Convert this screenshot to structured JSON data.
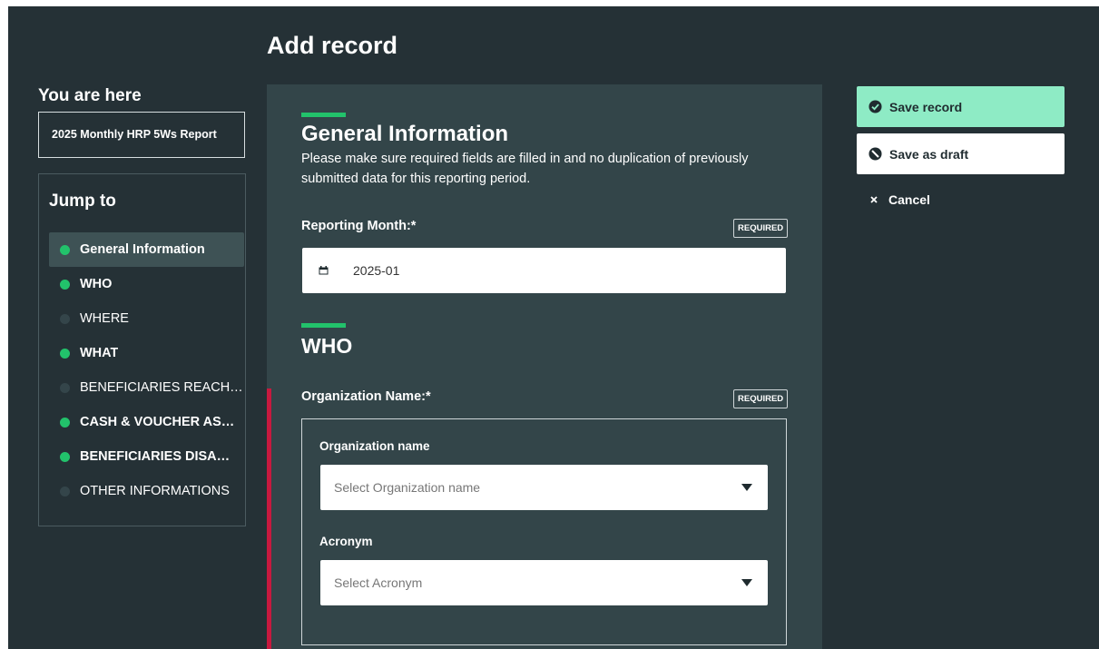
{
  "page": {
    "title": "Add record"
  },
  "sidebar": {
    "you_are_here": "You are here",
    "breadcrumb": "2025 Monthly HRP 5Ws Report",
    "jump_to": "Jump to",
    "items": [
      {
        "label": "General Information",
        "status": "complete",
        "active": true
      },
      {
        "label": "WHO",
        "status": "complete",
        "active": false
      },
      {
        "label": "WHERE",
        "status": "incomplete",
        "active": false
      },
      {
        "label": "WHAT",
        "status": "complete",
        "active": false
      },
      {
        "label": "BENEFICIARIES REACHED",
        "status": "incomplete",
        "active": false
      },
      {
        "label": "CASH & VOUCHER ASSISTANCE",
        "status": "complete",
        "active": false
      },
      {
        "label": "BENEFICIARIES DISAGGREGATION",
        "status": "complete",
        "active": false
      },
      {
        "label": "OTHER INFORMATIONS",
        "status": "incomplete",
        "active": false
      }
    ]
  },
  "form": {
    "general": {
      "title": "General Information",
      "description": "Please make sure required fields are filled in and no duplication of previously submitted data for this reporting period.",
      "reporting_month_label": "Reporting Month:*",
      "required_badge": "REQUIRED",
      "reporting_month_value": "2025-01"
    },
    "who": {
      "title": "WHO",
      "org_label": "Organization Name:*",
      "required_badge": "REQUIRED",
      "org_name_label": "Organization name",
      "org_name_placeholder": "Select Organization name",
      "acronym_label": "Acronym",
      "acronym_placeholder": "Select Acronym"
    }
  },
  "actions": {
    "save_record": "Save record",
    "save_draft": "Save as draft",
    "cancel": "Cancel"
  },
  "colors": {
    "background": "#253136",
    "panel": "#334549",
    "accent_green": "#22c26b",
    "save_button": "#8eebc5",
    "error": "#c8193f"
  },
  "icons": {
    "calendar": "calendar-icon",
    "caret": "chevron-down-icon",
    "save": "check-circle-icon",
    "draft": "ban-icon",
    "cancel": "close-icon"
  }
}
